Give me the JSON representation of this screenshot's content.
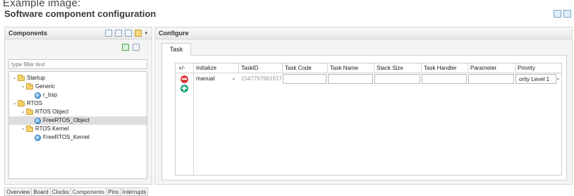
{
  "caption": "Example image:",
  "window": {
    "title": "Software component configuration"
  },
  "components_panel": {
    "title": "Components",
    "filter_placeholder": "type filter text",
    "tree": [
      {
        "label": "Startup",
        "kind": "folder",
        "expanded": true
      },
      {
        "label": "Generic",
        "kind": "folder",
        "expanded": true
      },
      {
        "label": "r_bsp",
        "kind": "component"
      },
      {
        "label": "RTOS",
        "kind": "folder",
        "expanded": true
      },
      {
        "label": "RTOS Object",
        "kind": "folder",
        "expanded": true
      },
      {
        "label": "FreeRTOS_Object",
        "kind": "component",
        "selected": true
      },
      {
        "label": "RTOS Kernel",
        "kind": "folder",
        "expanded": true
      },
      {
        "label": "FreeRTOS_Kernel",
        "kind": "component"
      }
    ]
  },
  "configure_panel": {
    "title": "Configure",
    "active_tab": "Task",
    "table": {
      "headers": [
        "+/-",
        "Initialize",
        "TaskID",
        "Task Code",
        "Task Name",
        "Stack Size",
        "Task Handler",
        "Parameter",
        "Priority"
      ],
      "row": {
        "initialize": "manual",
        "task_id": "1547797661817",
        "task_code": "",
        "task_name": "",
        "stack_size": "",
        "task_handler": "",
        "parameter": "",
        "priority": "ority Level 1"
      }
    }
  },
  "bottom_tabs": [
    "Overview",
    "Board",
    "Clocks",
    "Components",
    "Pins",
    "Interrupts"
  ],
  "active_bottom_tab": "Components",
  "colors": {
    "remove": "#d93f3f",
    "add": "#1aa37a",
    "folder": "#f6d16b",
    "selection": "#dedede"
  }
}
